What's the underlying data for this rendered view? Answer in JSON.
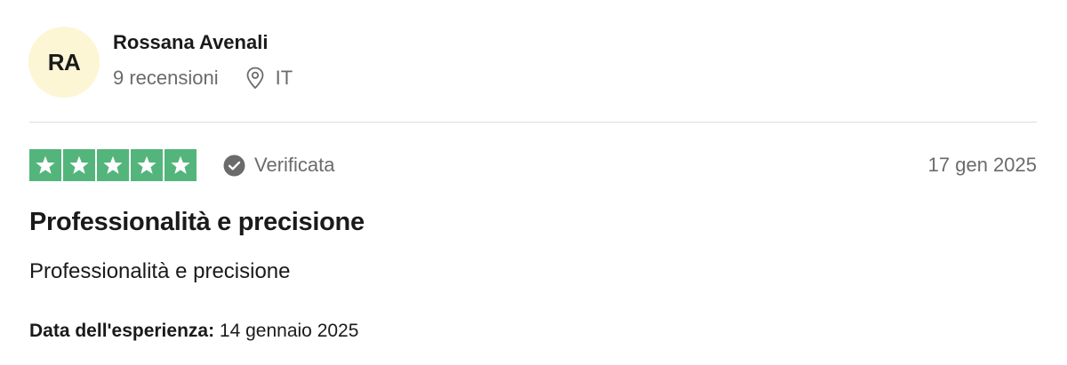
{
  "reviewer": {
    "initials": "RA",
    "name": "Rossana Avenali",
    "review_count": "9 recensioni",
    "country": "IT",
    "avatar_color": "#fcf6d4"
  },
  "review": {
    "rating": 5,
    "rating_max": 5,
    "star_color": "#53b57c",
    "verified_label": "Verificata",
    "date": "17 gen 2025",
    "title": "Professionalità e precisione",
    "body": "Professionalità e precisione",
    "experience_label": "Data dell'esperienza:",
    "experience_date": "14 gennaio 2025"
  },
  "icons": {
    "location": "map-pin-icon",
    "verified": "check-circle-icon",
    "star": "star-icon"
  }
}
